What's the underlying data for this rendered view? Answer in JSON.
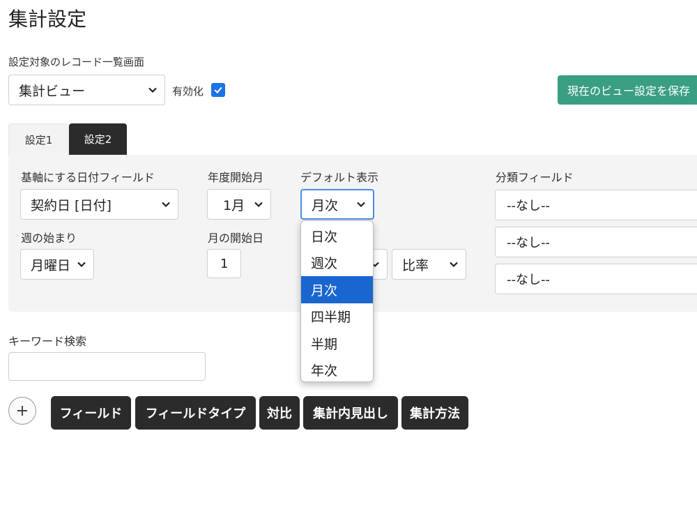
{
  "page": {
    "title": "集計設定"
  },
  "target": {
    "label": "設定対象のレコード一覧画面",
    "selected": "集計ビュー",
    "enable_label": "有効化",
    "enabled": true
  },
  "save_button": "現在のビュー設定を保存",
  "tabs": [
    {
      "label": "設定1",
      "active": false
    },
    {
      "label": "設定2",
      "active": true
    }
  ],
  "settings": {
    "date_field": {
      "label": "基軸にする日付フィールド",
      "value": "契約日 [日付]"
    },
    "fiscal_month": {
      "label": "年度開始月",
      "value": "1月"
    },
    "default_view": {
      "label": "デフォルト表示",
      "value": "月次",
      "options": [
        "日次",
        "週次",
        "月次",
        "四半期",
        "半期",
        "年次"
      ],
      "selected_index": 2
    },
    "category_field": {
      "label": "分類フィールド",
      "values": [
        "--なし--",
        "--なし--",
        "--なし--"
      ]
    },
    "week_start": {
      "label": "週の始まり",
      "value": "月曜日"
    },
    "month_start": {
      "label": "月の開始日",
      "value": "1"
    },
    "ratio": {
      "value": "比率"
    }
  },
  "keyword": {
    "label": "キーワード検索",
    "value": ""
  },
  "buttons": [
    "フィールド",
    "フィールドタイプ",
    "対比",
    "集計内見出し",
    "集計方法"
  ],
  "colors": {
    "accent": "#3a9e83",
    "selected": "#1a66d0",
    "dark": "#2b2b2b"
  }
}
